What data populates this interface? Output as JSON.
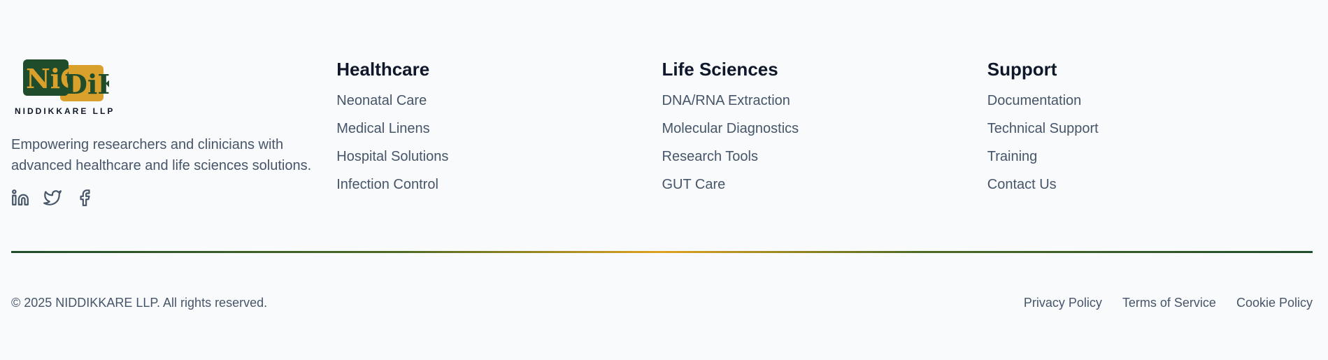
{
  "brand": {
    "logo_main": "NiC",
    "logo_accent": "DiK",
    "logo_text": "NIDDIKKARE LLP",
    "description": "Empowering researchers and clinicians with advanced healthcare and life sciences solutions.",
    "social": [
      "linkedin-icon",
      "twitter-icon",
      "facebook-icon"
    ]
  },
  "columns": [
    {
      "title": "Healthcare",
      "items": [
        "Neonatal Care",
        "Medical Linens",
        "Hospital Solutions",
        "Infection Control"
      ]
    },
    {
      "title": "Life Sciences",
      "items": [
        "DNA/RNA Extraction",
        "Molecular Diagnostics",
        "Research Tools",
        "GUT Care"
      ]
    },
    {
      "title": "Support",
      "items": [
        "Documentation",
        "Technical Support",
        "Training",
        "Contact Us"
      ]
    }
  ],
  "bottom": {
    "copyright": "© 2025 NIDDIKKARE LLP. All rights reserved.",
    "links": [
      "Privacy Policy",
      "Terms of Service",
      "Cookie Policy"
    ]
  },
  "colors": {
    "brand_green": "#1f4d2b",
    "brand_gold": "#e0a221",
    "text": "#475569",
    "heading": "#0f172a"
  }
}
